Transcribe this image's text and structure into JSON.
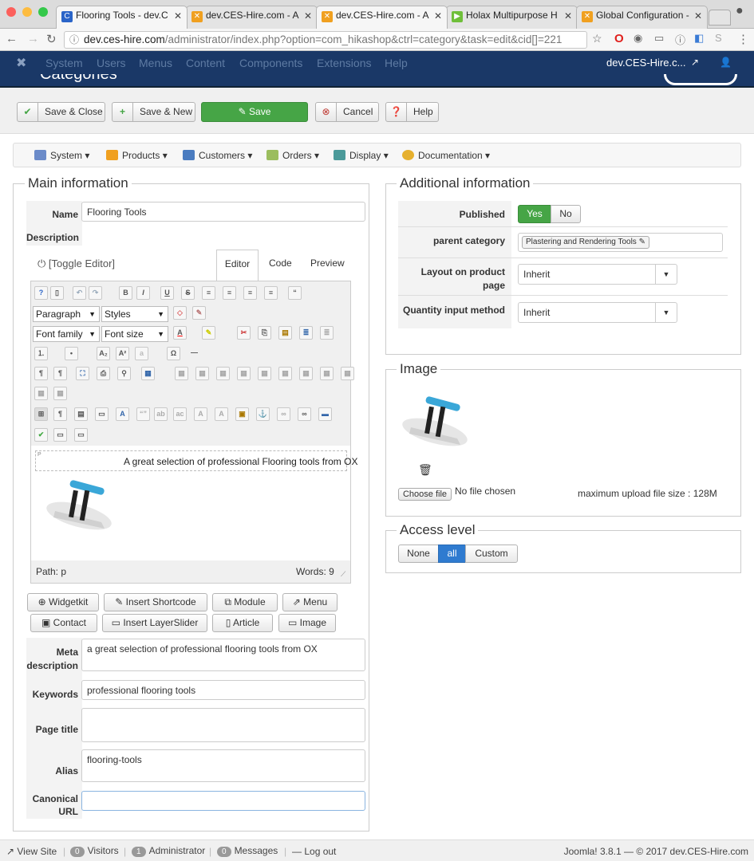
{
  "browser": {
    "tabs": [
      {
        "label": "Flooring Tools - dev.C",
        "fav": "C",
        "favcolor": "#2a64c8"
      },
      {
        "label": "dev.CES-Hire.com - A",
        "fav": "J",
        "favcolor": "#f0a020"
      },
      {
        "label": "dev.CES-Hire.com - A",
        "fav": "J",
        "favcolor": "#f0a020"
      },
      {
        "label": "Holax Multipurpose H",
        "fav": "▶",
        "favcolor": "#6fbf3a"
      },
      {
        "label": "Global Configuration -",
        "fav": "J",
        "favcolor": "#f0a020"
      }
    ],
    "url_host": "dev.ces-hire.com",
    "url_path": "/administrator/index.php?option=com_hikashop&ctrl=category&task=edit&cid[]=221"
  },
  "topbar": {
    "menu": [
      "System",
      "Users",
      "Menus",
      "Content",
      "Components",
      "Extensions",
      "Help"
    ],
    "site": "dev.CES-Hire.c...",
    "page_title": "Categories"
  },
  "toolbar": {
    "save_close": "Save & Close",
    "save_new": "Save & New",
    "save": "Save",
    "cancel": "Cancel",
    "help": "Help"
  },
  "hikamenu": [
    "System",
    "Products",
    "Customers",
    "Orders",
    "Display",
    "Documentation"
  ],
  "main": {
    "legend": "Main information",
    "name_label": "Name",
    "name_value": "Flooring Tools",
    "desc_label": "Description",
    "toggle_editor": "[Toggle Editor]",
    "editor_tabs": [
      "Editor",
      "Code",
      "Preview"
    ],
    "format_select": "Paragraph",
    "styles_select": "Styles",
    "fontfamily_select": "Font family",
    "fontsize_select": "Font size",
    "content_text": "A great selection of professional Flooring tools from OX",
    "para_marker": "P",
    "path": "Path: p",
    "words": "Words: 9",
    "insert_buttons_row1": [
      "Widgetkit",
      "Insert Shortcode",
      "Module",
      "Menu"
    ],
    "insert_buttons_row2": [
      "Contact",
      "Insert LayerSlider",
      "Article",
      "Image"
    ],
    "meta_desc_label_1": "Meta",
    "meta_desc_label_2": "description",
    "meta_desc_value": "a great selection of professional flooring tools from OX",
    "keywords_label": "Keywords",
    "keywords_value": "professional flooring tools",
    "page_title_label": "Page title",
    "alias_label": "Alias",
    "alias_value": "flooring-tools",
    "canonical_label_1": "Canonical",
    "canonical_label_2": "URL"
  },
  "additional": {
    "legend": "Additional information",
    "published_label": "Published",
    "yes": "Yes",
    "no": "No",
    "parent_label": "parent category",
    "parent_value": "Plastering and Rendering Tools",
    "layout_label_1": "Layout on product",
    "layout_label_2": "page",
    "layout_value": "Inherit",
    "qty_label": "Quantity input method",
    "qty_value": "Inherit"
  },
  "image": {
    "legend": "Image",
    "choose_file": "Choose file",
    "no_file": "No file chosen",
    "max_size": "maximum upload file size : 128M"
  },
  "access": {
    "legend": "Access level",
    "options": [
      "None",
      "all",
      "Custom"
    ],
    "selected": "all"
  },
  "status": {
    "view_site": "View Site",
    "visitors_count": "0",
    "visitors": "Visitors",
    "admin_count": "1",
    "administrator": "Administrator",
    "messages_count": "0",
    "messages": "Messages",
    "logout": "Log out",
    "footer": "Joomla! 3.8.1  —  © 2017 dev.CES-Hire.com"
  }
}
